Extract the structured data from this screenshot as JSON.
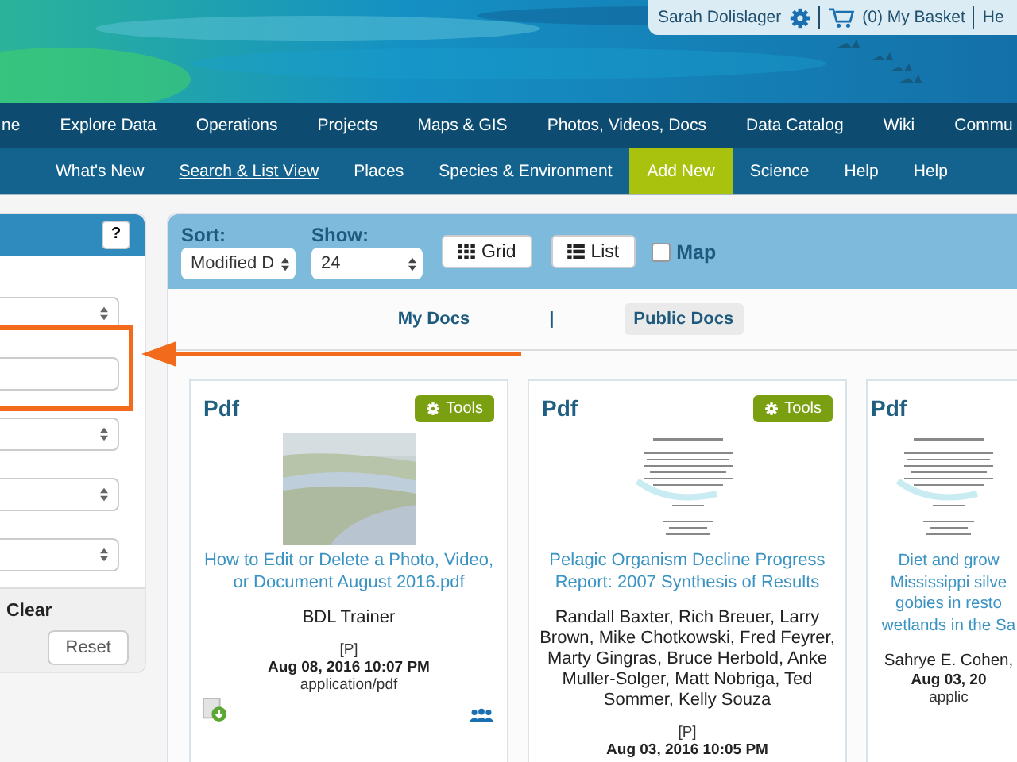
{
  "user_bar": {
    "user": "Sarah Dolislager",
    "basket": "(0) My Basket",
    "cut_link": "He"
  },
  "main_nav": [
    {
      "label": "ne"
    },
    {
      "label": "Explore Data"
    },
    {
      "label": "Operations"
    },
    {
      "label": "Projects"
    },
    {
      "label": "Maps & GIS"
    },
    {
      "label": "Photos, Videos, Docs"
    },
    {
      "label": "Data Catalog"
    },
    {
      "label": "Wiki"
    },
    {
      "label": "Commu"
    }
  ],
  "sub_nav": [
    {
      "label": "What's New",
      "selected": false,
      "current": false
    },
    {
      "label": "Search & List View",
      "selected": false,
      "current": true
    },
    {
      "label": "Places",
      "selected": false,
      "current": false
    },
    {
      "label": "Species & Environment",
      "selected": false,
      "current": false
    },
    {
      "label": "Add New",
      "selected": true,
      "current": false
    },
    {
      "label": "Science",
      "selected": false,
      "current": false
    },
    {
      "label": "Help",
      "selected": false,
      "current": false
    },
    {
      "label": "Help",
      "selected": false,
      "current": false
    }
  ],
  "sidebar": {
    "help_button": "?",
    "fields": [
      {
        "kind": "select"
      },
      {
        "kind": "input"
      },
      {
        "kind": "select"
      },
      {
        "kind": "select"
      },
      {
        "kind": "select"
      }
    ],
    "clear": "Clear",
    "reset": "Reset"
  },
  "toolbar": {
    "sort_label": "Sort:",
    "sort_value": "Modified D",
    "show_label": "Show:",
    "show_value": "24",
    "grid": "Grid",
    "list": "List",
    "map": {
      "label": "Map",
      "checked": false
    }
  },
  "doc_tabs": [
    {
      "label": "My Docs",
      "selected": false
    },
    {
      "label": "Public Docs",
      "selected": true
    }
  ],
  "doc_tab_separator": "|",
  "cards": [
    {
      "type": "Pdf",
      "tools": "Tools",
      "thumbnail": {
        "kind": "picture"
      },
      "title_lines": [
        "How to Edit or Delete a Photo, Video,",
        "or Document August 2016.pdf"
      ],
      "author_lines": [
        "BDL Trainer"
      ],
      "access": "[P]",
      "date": "Aug 08, 2016 10:07 PM",
      "mime": "application/pdf"
    },
    {
      "type": "Pdf",
      "tools": "Tools",
      "thumbnail": {
        "kind": "document"
      },
      "title_lines": [
        "Pelagic Organism Decline Progress",
        "Report: 2007 Synthesis of Results"
      ],
      "author_lines": [
        "Randall Baxter, Rich Breuer, Larry",
        "Brown, Mike Chotkowski, Fred Feyrer,",
        "Marty Gingras, Bruce Herbold, Anke",
        "Muller-Solger, Matt Nobriga, Ted",
        "Sommer, Kelly Souza"
      ],
      "access": "[P]",
      "date": "Aug 03, 2016 10:05 PM"
    },
    {
      "type": "Pdf",
      "thumbnail": {
        "kind": "document"
      },
      "title_lines": [
        "Diet and grow",
        "Mississippi silve",
        "gobies in resto",
        "wetlands in the Sa"
      ],
      "author_lines": [
        "Sahrye E. Cohen,"
      ],
      "date": "Aug 03, 20",
      "mime": "applic"
    }
  ]
}
